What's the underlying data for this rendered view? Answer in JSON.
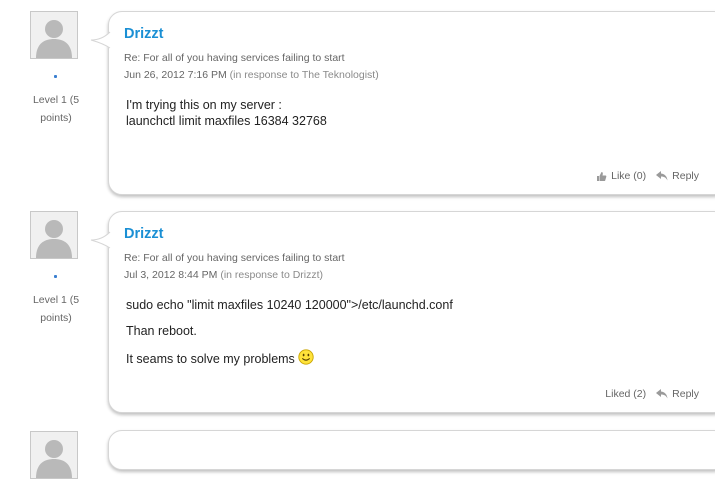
{
  "posts": [
    {
      "author": "Drizzt",
      "level": "Level 1 (5 points)",
      "subject": "Re: For all of you having services failing to start",
      "date": "Jun 26, 2012 7:16 PM",
      "in_response": "(in response to The Teknologist)",
      "body": [
        "I'm trying this on my server :",
        "launchctl limit maxfiles 16384 32768"
      ],
      "like_label": "Like (0)",
      "reply_label": "Reply"
    },
    {
      "author": "Drizzt",
      "level": "Level 1 (5 points)",
      "subject": "Re: For all of you having services failing to start",
      "date": "Jul 3, 2012 8:44 PM",
      "in_response": "(in response to Drizzt)",
      "body": [
        "sudo echo \"limit maxfiles 10240 120000\">/etc/launchd.conf",
        "Than reboot.",
        "It seams to solve my problems"
      ],
      "like_label": "Liked (2)",
      "reply_label": "Reply"
    }
  ],
  "icons": {
    "avatar": "default-user-avatar-icon",
    "like": "thumbs-up-icon",
    "reply": "reply-arrow-icon",
    "smiley": "smiley-emoticon-icon"
  },
  "colors": {
    "author_link": "#1a8fd4",
    "status_dot": "#3a7fd0"
  }
}
